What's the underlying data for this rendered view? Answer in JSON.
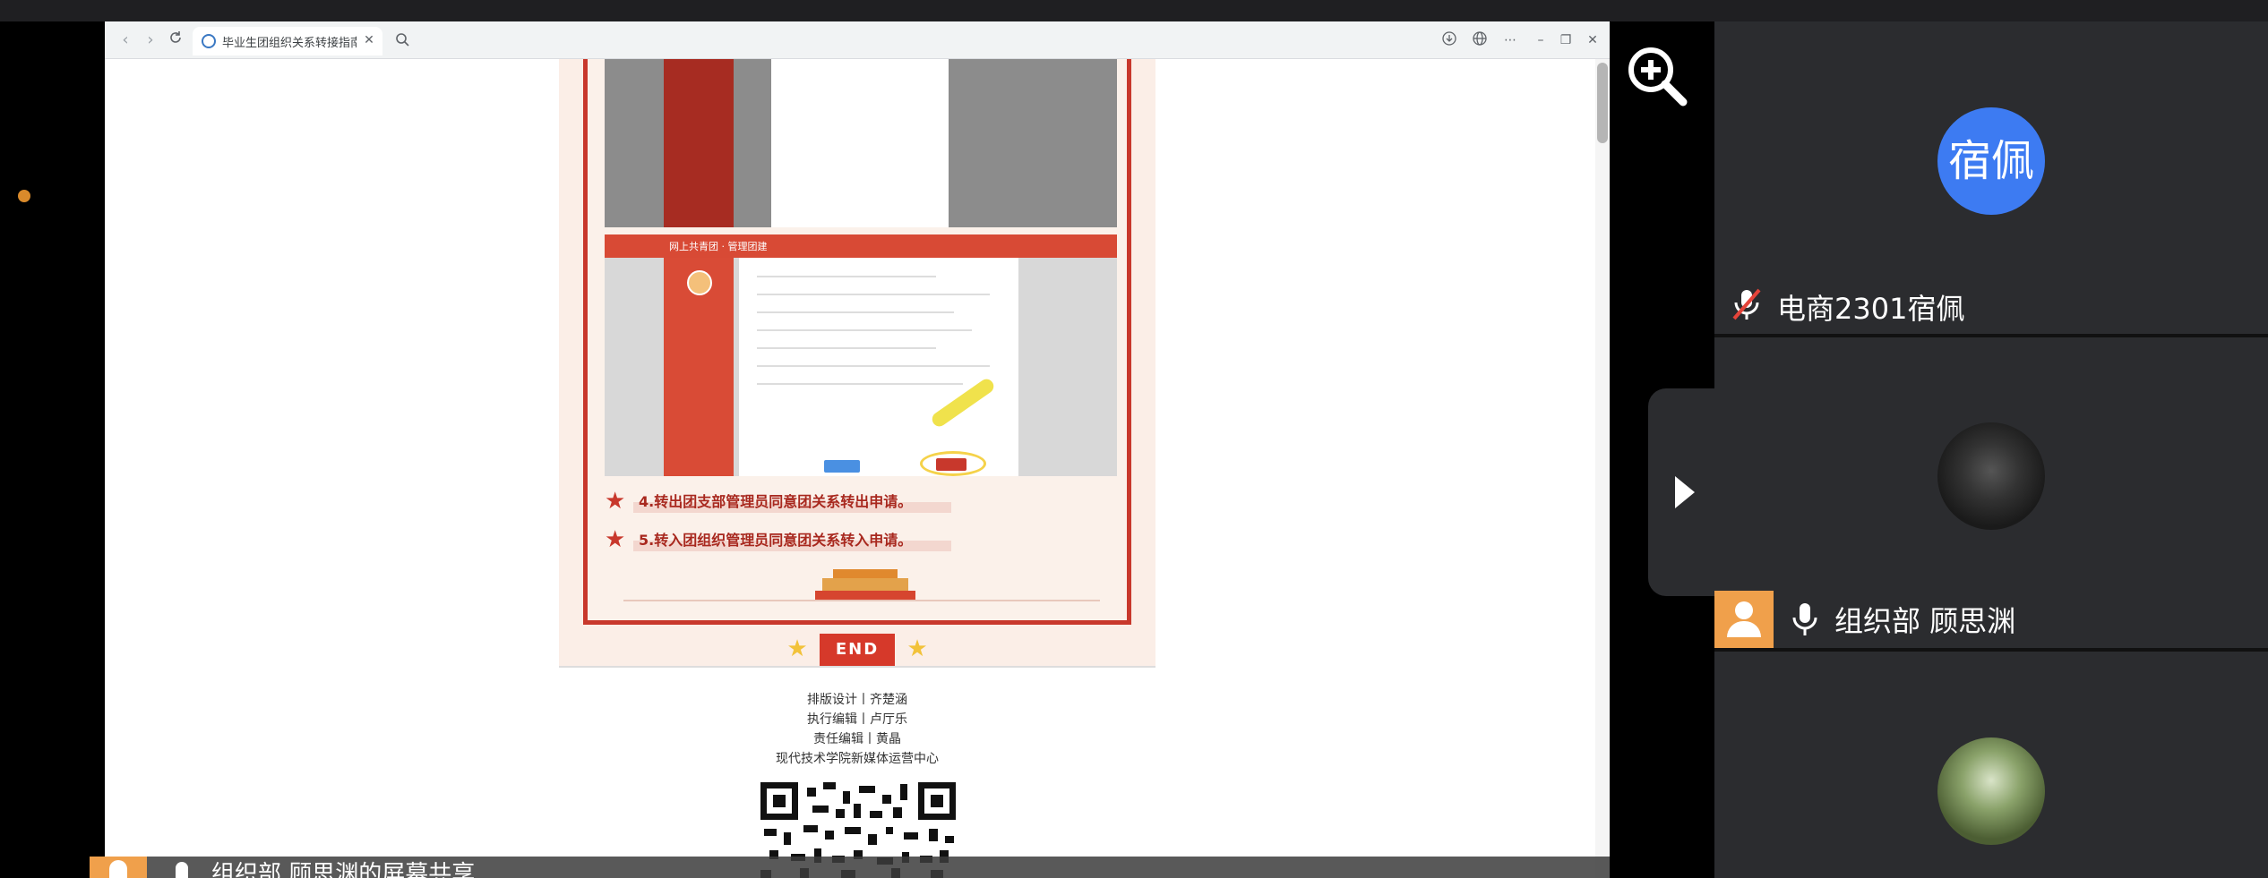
{
  "browser": {
    "tab_title": "毕业生团组织关系转接指南"
  },
  "article": {
    "step4": "4.转出团支部管理员同意团关系转出申请。",
    "step5": "5.转入团组织管理员同意团关系转入申请。",
    "end_label": "END",
    "screenshot_header": "网上共青团 · 管理团建",
    "credits": [
      "排版设计丨齐楚涵",
      "执行编辑丨卢厅乐",
      "责任编辑丨黄晶",
      "现代技术学院新媒体运营中心"
    ]
  },
  "share_bar": {
    "label": "组织部 顾思渊的屏幕共享"
  },
  "participants": [
    {
      "avatar_text": "宿佩",
      "name": "电商2301宿佩",
      "mic": "muted"
    },
    {
      "name": "组织部 顾思渊",
      "mic": "on"
    },
    {
      "name": ""
    }
  ],
  "colors": {
    "accent_red": "#c8382c",
    "avatar_blue": "#3d7bf2",
    "badge_orange": "#f0a04b",
    "panel_bg": "#2b2c2f"
  },
  "icons": [
    "zoom-in-icon",
    "collapse-arrow-icon",
    "mic-muted-icon",
    "mic-icon",
    "user-icon",
    "search-icon",
    "refresh-icon",
    "close-icon",
    "download-icon",
    "translate-icon",
    "more-icon",
    "minimize-icon",
    "restore-icon"
  ]
}
